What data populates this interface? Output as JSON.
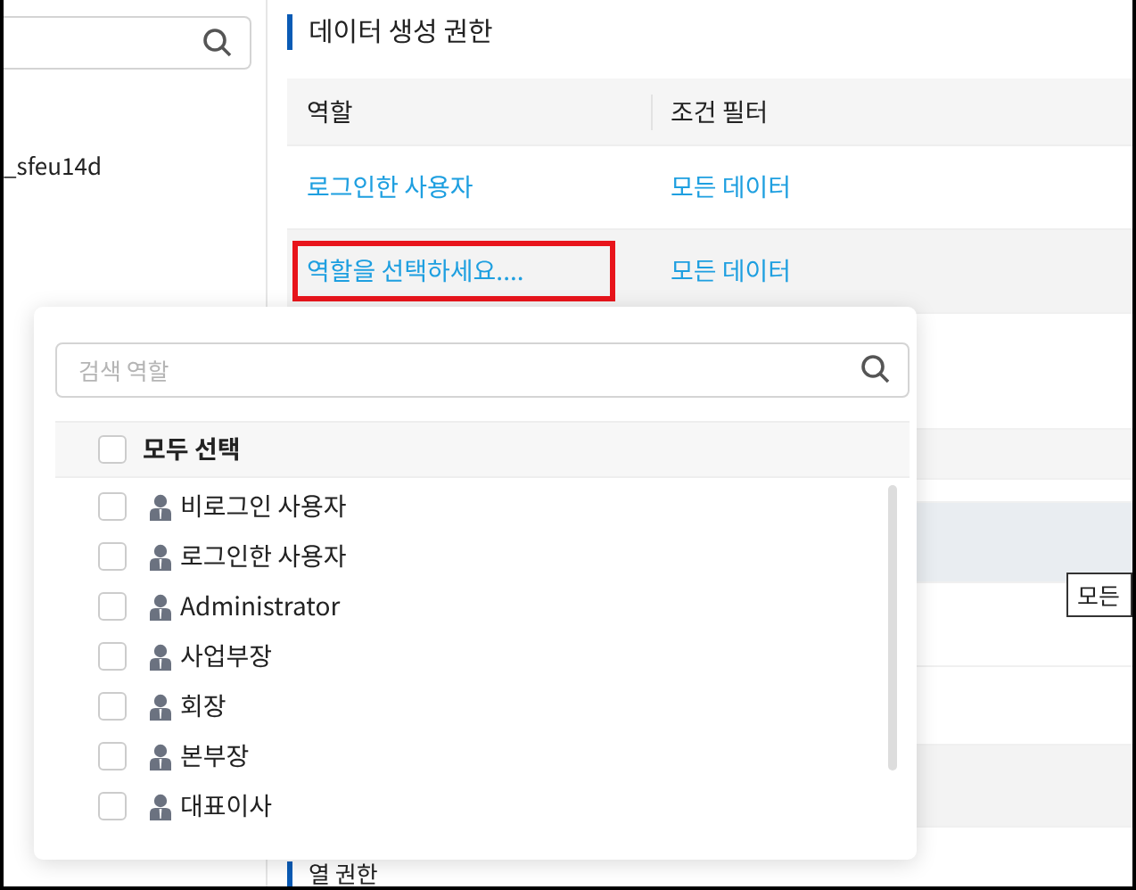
{
  "sidebar": {
    "items": [
      {
        "label": "_sfeu14d"
      }
    ]
  },
  "section": {
    "title": "데이터 생성 권한"
  },
  "table": {
    "columns": [
      "역할",
      "조건 필터"
    ],
    "rows": [
      {
        "role": "로그인한 사용자",
        "filter": "모든 데이터",
        "highlighted": false
      },
      {
        "role": "역할을 선택하세요....",
        "filter": "모든 데이터",
        "highlighted": true
      }
    ]
  },
  "tooltip": "모든",
  "next_section": {
    "title": "열 권한"
  },
  "dropdown": {
    "search": {
      "placeholder": "검색 역할"
    },
    "select_all": {
      "label": "모두 선택",
      "checked": false
    },
    "options": [
      {
        "label": "비로그인 사용자",
        "checked": false
      },
      {
        "label": "로그인한 사용자",
        "checked": false
      },
      {
        "label": "Administrator",
        "checked": false
      },
      {
        "label": "사업부장",
        "checked": false
      },
      {
        "label": "회장",
        "checked": false
      },
      {
        "label": "본부장",
        "checked": false
      },
      {
        "label": "대표이사",
        "checked": false
      }
    ]
  }
}
